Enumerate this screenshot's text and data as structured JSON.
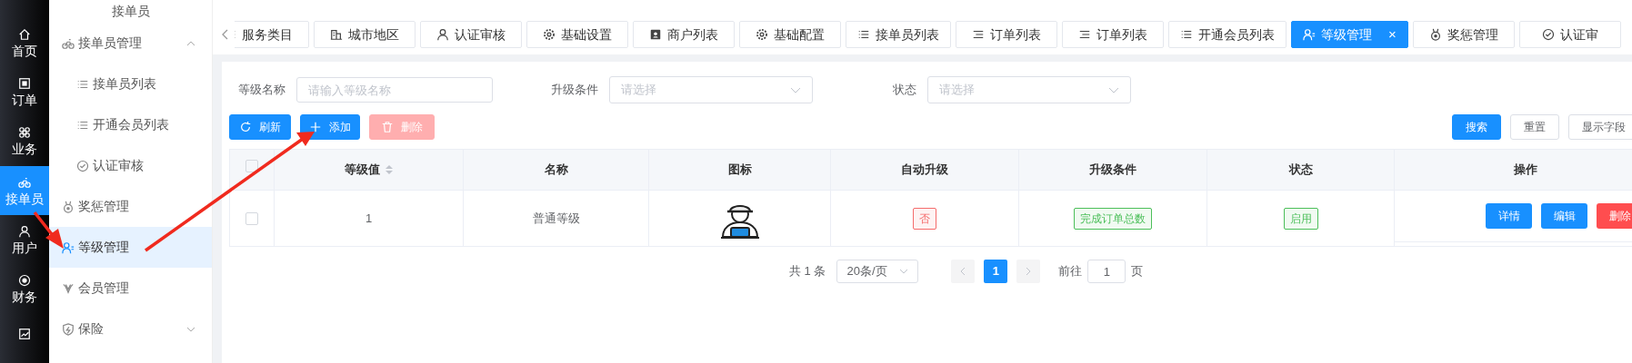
{
  "rail": [
    {
      "label": "首页",
      "selected": false
    },
    {
      "label": "订单",
      "selected": false
    },
    {
      "label": "业务",
      "selected": false
    },
    {
      "label": "接单员",
      "selected": true
    },
    {
      "label": "用户",
      "selected": false
    },
    {
      "label": "财务",
      "selected": false
    }
  ],
  "sidebar": {
    "title": "接单员",
    "items": [
      {
        "kind": "group",
        "label": "接单员管理",
        "expanded": true,
        "selected": false,
        "children": [
          {
            "label": "接单员列表",
            "selected": false
          },
          {
            "label": "开通会员列表",
            "selected": false
          },
          {
            "label": "认证审核",
            "selected": false
          }
        ]
      },
      {
        "kind": "item",
        "label": "奖惩管理",
        "selected": false
      },
      {
        "kind": "item",
        "label": "等级管理",
        "selected": true
      },
      {
        "kind": "item",
        "label": "会员管理",
        "selected": false
      },
      {
        "kind": "group",
        "label": "保险",
        "expanded": false,
        "selected": false
      }
    ]
  },
  "tabs": [
    {
      "label": "服务类目",
      "selected": false
    },
    {
      "label": "城市地区",
      "selected": false
    },
    {
      "label": "认证审核",
      "selected": false
    },
    {
      "label": "基础设置",
      "selected": false
    },
    {
      "label": "商户列表",
      "selected": false
    },
    {
      "label": "基础配置",
      "selected": false
    },
    {
      "label": "接单员列表",
      "selected": false
    },
    {
      "label": "订单列表",
      "selected": false
    },
    {
      "label": "订单列表",
      "selected": false
    },
    {
      "label": "开通会员列表",
      "selected": false
    },
    {
      "label": "等级管理",
      "selected": true,
      "close": "×"
    },
    {
      "label": "奖惩管理",
      "selected": false
    },
    {
      "label": "认证审",
      "selected": false
    }
  ],
  "filters": [
    {
      "kind": "input",
      "label": "等级名称",
      "placeholder": "请输入等级名称"
    },
    {
      "kind": "select",
      "label": "升级条件",
      "placeholder": "请选择"
    },
    {
      "kind": "select",
      "label": "状态",
      "placeholder": "请选择"
    }
  ],
  "actions": [
    {
      "label": "刷新",
      "kind": "primary",
      "disabled": false
    },
    {
      "label": "添加",
      "kind": "primary",
      "disabled": false
    },
    {
      "label": "删除",
      "kind": "danger",
      "disabled": true
    }
  ],
  "search_actions": [
    {
      "label": "搜索",
      "kind": "primary"
    },
    {
      "label": "重置",
      "kind": "default"
    },
    {
      "label": "显示字段",
      "kind": "default"
    }
  ],
  "table": {
    "select_all": {
      "checked": false
    },
    "columns": [
      {
        "label": "等级值",
        "sortable": true
      },
      {
        "label": "名称",
        "sortable": false
      },
      {
        "label": "图标",
        "sortable": false
      },
      {
        "label": "自动升级",
        "sortable": false
      },
      {
        "label": "升级条件",
        "sortable": false
      },
      {
        "label": "状态",
        "sortable": false
      },
      {
        "label": "操作",
        "sortable": false
      }
    ],
    "rows": [
      {
        "checked": false,
        "level_value": "1",
        "name": "普通等级",
        "auto_upgrade": {
          "text": "否",
          "color": "#f56c6c"
        },
        "condition": {
          "text": "完成订单总数",
          "color": "#4cbf5a"
        },
        "status": {
          "text": "启用",
          "color": "#4cbf5a"
        },
        "operations": [
          {
            "label": "详情",
            "kind": "primary"
          },
          {
            "label": "编辑",
            "kind": "primary"
          },
          {
            "label": "删除",
            "kind": "danger"
          }
        ]
      }
    ]
  },
  "pagination": {
    "total": "共 1 条",
    "page_size": "20条/页",
    "pages": [
      {
        "label": "1",
        "selected": true
      }
    ],
    "goto_label": "前往",
    "goto_value": "1",
    "page_suffix": "页"
  }
}
